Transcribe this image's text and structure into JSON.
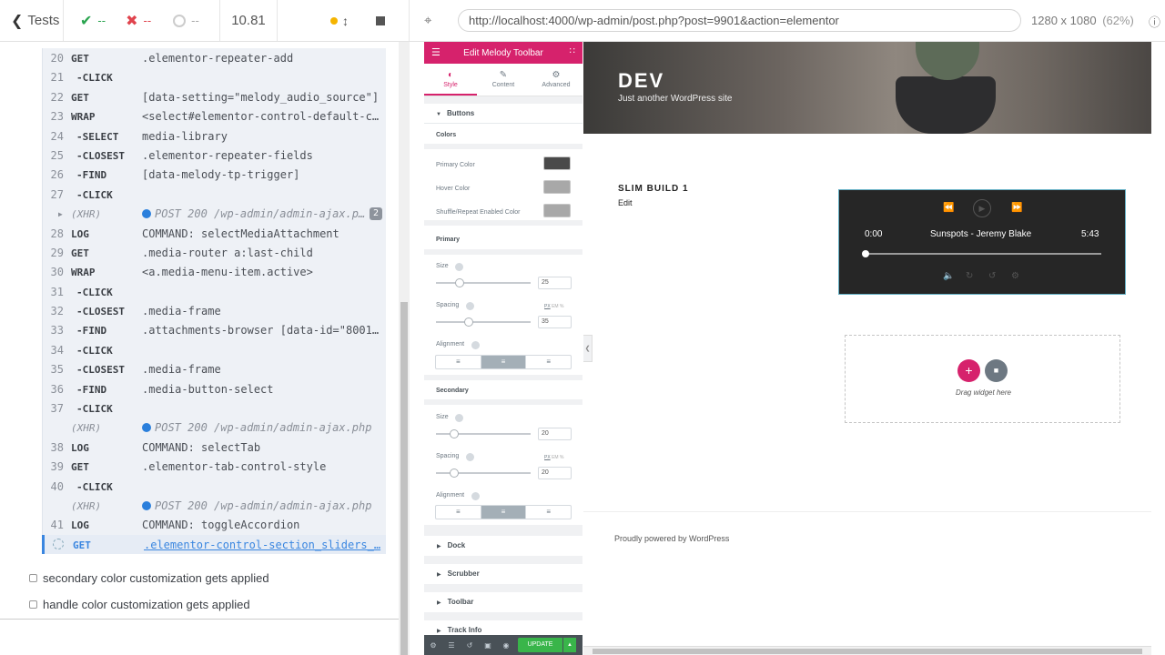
{
  "runner": {
    "back_label": "Tests",
    "passed": "--",
    "failed": "--",
    "pending": "--",
    "duration": "10.81",
    "url": "http://localhost:4000/wp-admin/post.php?post=9901&action=elementor",
    "viewport": "1280 x 1080",
    "scale": "(62%)"
  },
  "commands": [
    {
      "num": "20",
      "name": "GET",
      "msg": ".elementor-repeater-add",
      "child": false
    },
    {
      "num": "21",
      "name": "-CLICK",
      "msg": "",
      "child": true
    },
    {
      "num": "22",
      "name": "GET",
      "msg": "[data-setting=\"melody_audio_source\"]",
      "child": false
    },
    {
      "num": "23",
      "name": "WRAP",
      "msg": "<select#elementor-control-default-c…",
      "child": false
    },
    {
      "num": "24",
      "name": "-SELECT",
      "msg": "media-library",
      "child": true
    },
    {
      "num": "25",
      "name": "-CLOSEST",
      "msg": ".elementor-repeater-fields",
      "child": true
    },
    {
      "num": "26",
      "name": "-FIND",
      "msg": "[data-melody-tp-trigger]",
      "child": true
    },
    {
      "num": "27",
      "name": "-CLICK",
      "msg": "",
      "child": true
    },
    {
      "num": "",
      "name": "(XHR)",
      "msg": "POST 200 /wp-admin/admin-ajax.p…",
      "xhr": true,
      "badge": "2"
    },
    {
      "num": "28",
      "name": "LOG",
      "msg": "COMMAND: selectMediaAttachment",
      "child": false
    },
    {
      "num": "29",
      "name": "GET",
      "msg": ".media-router a:last-child",
      "child": false
    },
    {
      "num": "30",
      "name": "WRAP",
      "msg": "<a.media-menu-item.active>",
      "child": false
    },
    {
      "num": "31",
      "name": "-CLICK",
      "msg": "",
      "child": true
    },
    {
      "num": "32",
      "name": "-CLOSEST",
      "msg": ".media-frame",
      "child": true
    },
    {
      "num": "33",
      "name": "-FIND",
      "msg": ".attachments-browser [data-id=\"8001…",
      "child": true
    },
    {
      "num": "34",
      "name": "-CLICK",
      "msg": "",
      "child": true
    },
    {
      "num": "35",
      "name": "-CLOSEST",
      "msg": ".media-frame",
      "child": true
    },
    {
      "num": "36",
      "name": "-FIND",
      "msg": ".media-button-select",
      "child": true
    },
    {
      "num": "37",
      "name": "-CLICK",
      "msg": "",
      "child": true
    },
    {
      "num": "",
      "name": "(XHR)",
      "msg": "POST 200 /wp-admin/admin-ajax.php",
      "xhr": true
    },
    {
      "num": "38",
      "name": "LOG",
      "msg": "COMMAND: selectTab",
      "child": false
    },
    {
      "num": "39",
      "name": "GET",
      "msg": ".elementor-tab-control-style",
      "child": false
    },
    {
      "num": "40",
      "name": "-CLICK",
      "msg": "",
      "child": true
    },
    {
      "num": "",
      "name": "(XHR)",
      "msg": "POST 200 /wp-admin/admin-ajax.php",
      "xhr": true
    },
    {
      "num": "41",
      "name": "LOG",
      "msg": "COMMAND: toggleAccordion",
      "child": false
    },
    {
      "num": "",
      "name": "GET",
      "msg": ".elementor-control-section_sliders_…",
      "active": true
    }
  ],
  "tests": [
    "secondary color customization gets applied",
    "handle color customization gets applied"
  ],
  "panel": {
    "title": "Edit Melody Toolbar",
    "tabs": [
      "Style",
      "Content",
      "Advanced"
    ],
    "section_buttons": "Buttons",
    "colors_heading": "Colors",
    "primary_color_label": "Primary Color",
    "hover_color_label": "Hover Color",
    "shuffle_color_label": "Shuffle/Repeat Enabled Color",
    "primary_color": "#4a4a4a",
    "hover_color": "#a8a8a8",
    "shuffle_color": "#a8a8a8",
    "primary_heading": "Primary",
    "secondary_heading": "Secondary",
    "size_label": "Size",
    "spacing_label": "Spacing",
    "alignment_label": "Alignment",
    "primary_size": "25",
    "primary_spacing": "35",
    "secondary_size": "20",
    "secondary_spacing": "20",
    "units": [
      "PX",
      "EM",
      "%"
    ],
    "collapsed_sections": [
      "Dock",
      "Scrubber",
      "Toolbar",
      "Track Info"
    ],
    "update_label": "UPDATE"
  },
  "preview": {
    "site_title": "DEV",
    "site_desc": "Just another WordPress site",
    "post_title": "SLIM BUILD 1",
    "edit_label": "Edit",
    "time_current": "0:00",
    "track": "Sunspots - Jeremy Blake",
    "time_total": "5:43",
    "drag_text": "Drag widget here",
    "footer": "Proudly powered by WordPress"
  }
}
